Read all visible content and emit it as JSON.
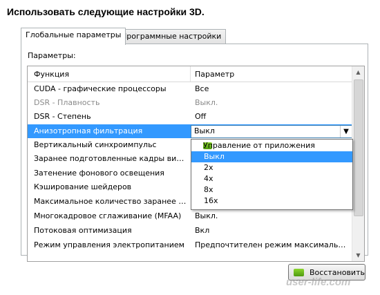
{
  "heading": "Использовать следующие настройки 3D.",
  "tabs": [
    {
      "label": "Глобальные параметры",
      "active": true
    },
    {
      "label": "Программные настройки",
      "active": false
    }
  ],
  "params_label": "Параметры:",
  "grid": {
    "headers": {
      "function": "Функция",
      "value": "Параметр"
    },
    "rows": [
      {
        "function": "CUDA - графические процессоры",
        "value": "Все",
        "disabled": false
      },
      {
        "function": "DSR - Плавность",
        "value": "Выкл.",
        "disabled": true
      },
      {
        "function": "DSR - Степень",
        "value": "Off",
        "disabled": false
      },
      {
        "function": "Анизотропная фильтрация",
        "value": "Выкл",
        "selected": true
      },
      {
        "function": "Вертикальный синхроимпульс",
        "value": ""
      },
      {
        "function": "Заранее подготовленные кадры вирту...",
        "value": ""
      },
      {
        "function": "Затенение фонового освещения",
        "value": ""
      },
      {
        "function": "Кэширование шейдеров",
        "value": ""
      },
      {
        "function": "Максимальное количество заранее под...",
        "value": ""
      },
      {
        "function": "Многокадровое сглаживание (MFAA)",
        "value": "Выкл."
      },
      {
        "function": "Потоковая оптимизация",
        "value": "Вкл"
      },
      {
        "function": "Режим управления электропитанием",
        "value": "Предпочтителен режим максимальной п..."
      }
    ]
  },
  "dropdown": {
    "options": [
      "Управление от приложения",
      "Выкл",
      "2x",
      "4x",
      "8x",
      "16x"
    ],
    "selected": "Выкл"
  },
  "restore_button": "Восстановить",
  "watermark": "user-life.com",
  "icons": {
    "combo_arrow": "chevron-down-icon",
    "nvidia": "nvidia-logo-icon"
  }
}
